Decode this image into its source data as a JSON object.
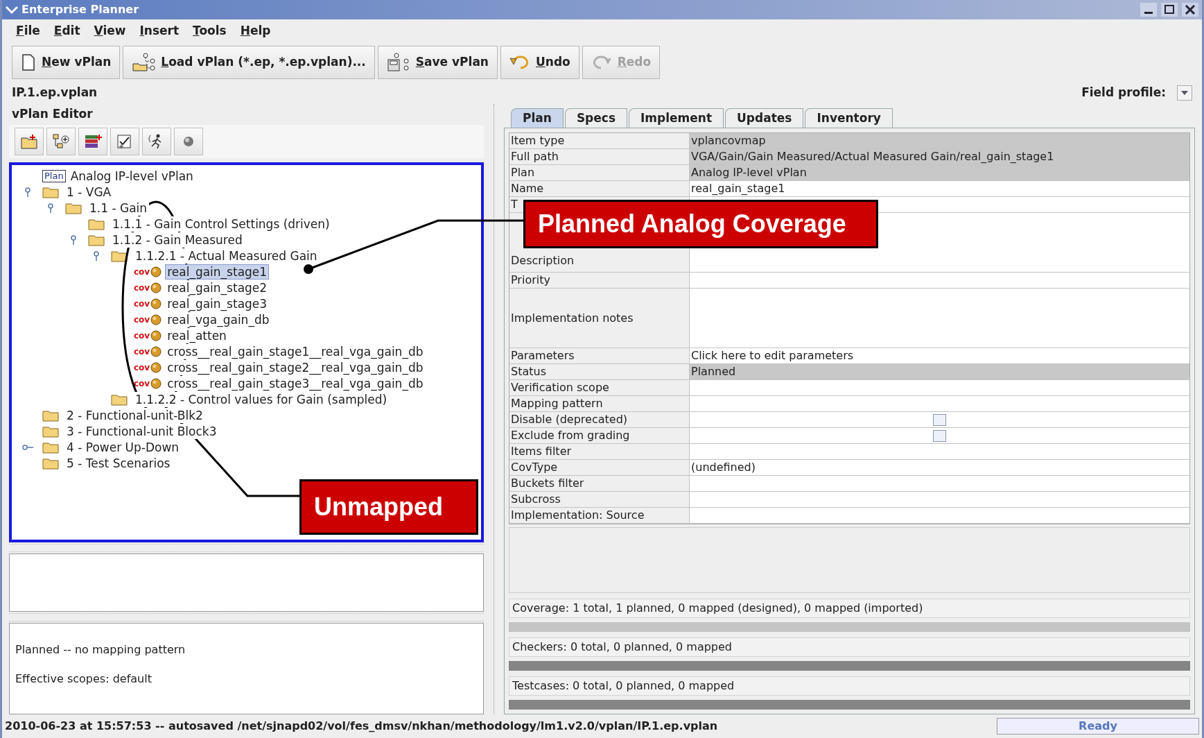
{
  "window": {
    "title": "Enterprise Planner"
  },
  "menu": [
    "File",
    "Edit",
    "View",
    "Insert",
    "Tools",
    "Help"
  ],
  "toolbar": [
    {
      "label": "New vPlan",
      "kind": "new",
      "disabled": false
    },
    {
      "label": "Load vPlan (*.ep, *.ep.vplan)...",
      "kind": "load",
      "disabled": false
    },
    {
      "label": "Save vPlan",
      "kind": "save",
      "disabled": false
    },
    {
      "label": "Undo",
      "kind": "undo",
      "disabled": false
    },
    {
      "label": "Redo",
      "kind": "redo",
      "disabled": true
    }
  ],
  "file_name": "IP.1.ep.vplan",
  "field_profile": {
    "label": "Field profile:"
  },
  "editor": {
    "title": "vPlan Editor",
    "tree": [
      {
        "label": "Analog IP-level vPlan",
        "kind": "plan",
        "badge": "Plan",
        "selected": false,
        "children": [
          {
            "label": "1 - VGA",
            "kind": "folder",
            "selected": false,
            "expanded": true,
            "children": [
              {
                "label": "1.1 - Gain",
                "kind": "folder",
                "selected": false,
                "expanded": true,
                "children": [
                  {
                    "label": "1.1.1 - Gain Control Settings (driven)",
                    "kind": "folder",
                    "selected": false
                  },
                  {
                    "label": "1.1.2 - Gain Measured",
                    "kind": "folder",
                    "selected": false,
                    "expanded": true,
                    "children": [
                      {
                        "label": "1.1.2.1 - Actual Measured Gain",
                        "kind": "folder",
                        "selected": false,
                        "expanded": true,
                        "children": [
                          {
                            "label": "real_gain_stage1",
                            "kind": "cov",
                            "badge": "cov",
                            "selected": true
                          },
                          {
                            "label": "real_gain_stage2",
                            "kind": "cov",
                            "badge": "cov",
                            "selected": false
                          },
                          {
                            "label": "real_gain_stage3",
                            "kind": "cov",
                            "badge": "cov",
                            "selected": false
                          },
                          {
                            "label": "real_vga_gain_db",
                            "kind": "cov",
                            "badge": "cov",
                            "selected": false
                          },
                          {
                            "label": "real_atten",
                            "kind": "cov",
                            "badge": "cov",
                            "selected": false
                          },
                          {
                            "label": "cross__real_gain_stage1__real_vga_gain_db",
                            "kind": "cov",
                            "badge": "cov",
                            "selected": false
                          },
                          {
                            "label": "cross__real_gain_stage2__real_vga_gain_db",
                            "kind": "cov",
                            "badge": "cov",
                            "selected": false
                          },
                          {
                            "label": "cross__real_gain_stage3__real_vga_gain_db",
                            "kind": "cov",
                            "badge": "cov",
                            "selected": false
                          }
                        ]
                      },
                      {
                        "label": "1.1.2.2 - Control values for Gain (sampled)",
                        "kind": "folder",
                        "selected": false
                      }
                    ]
                  }
                ]
              }
            ]
          },
          {
            "label": "2 - Functional-unit-Blk2",
            "kind": "folder",
            "selected": false
          },
          {
            "label": "3 - Functional-unit Block3",
            "kind": "folder",
            "selected": false
          },
          {
            "label": "4 - Power Up-Down",
            "kind": "folder",
            "selected": false,
            "expanded": false
          },
          {
            "label": "5 - Test Scenarios",
            "kind": "folder",
            "selected": false
          }
        ]
      }
    ]
  },
  "info": [
    "Planned -- no mapping pattern",
    "Effective scopes: default"
  ],
  "tabs": [
    {
      "label": "Plan",
      "selected": true
    },
    {
      "label": "Specs",
      "selected": false
    },
    {
      "label": "Implement",
      "selected": false
    },
    {
      "label": "Updates",
      "selected": false
    },
    {
      "label": "Inventory",
      "selected": false
    }
  ],
  "properties": [
    {
      "label": "Item type",
      "value": "vplancovmap",
      "kind": "text",
      "readonly": true
    },
    {
      "label": "Full path",
      "value": "VGA/Gain/Gain Measured/Actual Measured Gain/real_gain_stage1",
      "kind": "text",
      "readonly": true
    },
    {
      "label": "Plan",
      "value": "Analog IP-level vPlan",
      "kind": "text",
      "readonly": true
    },
    {
      "label": "Name",
      "value": "real_gain_stage1",
      "kind": "text",
      "readonly": false
    },
    {
      "label": "T",
      "kind": "text"
    },
    {
      "label": "Description",
      "kind": "multiline"
    },
    {
      "label": "Priority",
      "kind": "text"
    },
    {
      "label": "Implementation notes",
      "kind": "multiline"
    },
    {
      "label": "Parameters",
      "value": "Click here to edit parameters",
      "kind": "text",
      "readonly": false
    },
    {
      "label": "Status",
      "value": "Planned",
      "kind": "text",
      "readonly": true
    },
    {
      "label": "Verification scope",
      "kind": "text"
    },
    {
      "label": "Mapping pattern",
      "kind": "text"
    },
    {
      "label": "Disable (deprecated)",
      "kind": "checkbox",
      "checked": false,
      "readonly": false
    },
    {
      "label": "Exclude from grading",
      "kind": "checkbox",
      "checked": false,
      "readonly": false
    },
    {
      "label": "Items filter",
      "kind": "text"
    },
    {
      "label": "CovType",
      "value": "(undefined)",
      "kind": "text",
      "readonly": false
    },
    {
      "label": "Buckets filter",
      "kind": "text"
    },
    {
      "label": "Subcross",
      "kind": "text"
    },
    {
      "label": "Implementation: Source",
      "kind": "text"
    }
  ],
  "summaries": [
    {
      "text": "Coverage: 1 total, 1 planned, 0 mapped (designed), 0 mapped (imported)",
      "empty": false
    },
    {
      "text": "Checkers: 0 total, 0 planned, 0 mapped",
      "empty": true
    },
    {
      "text": "Testcases: 0 total, 0 planned, 0 mapped",
      "empty": true
    }
  ],
  "status_bar": {
    "message": "2010-06-23 at 15:57:53 -- autosaved /net/sjnapd02/vol/fes_dmsv/nkhan/methodology/lm1.v2.0/vplan/IP.1.ep.vplan",
    "state": "Ready"
  },
  "callouts": [
    {
      "text": "Planned Analog Coverage",
      "kind": "coverage"
    },
    {
      "text": "Unmapped",
      "kind": "unmapped"
    }
  ]
}
